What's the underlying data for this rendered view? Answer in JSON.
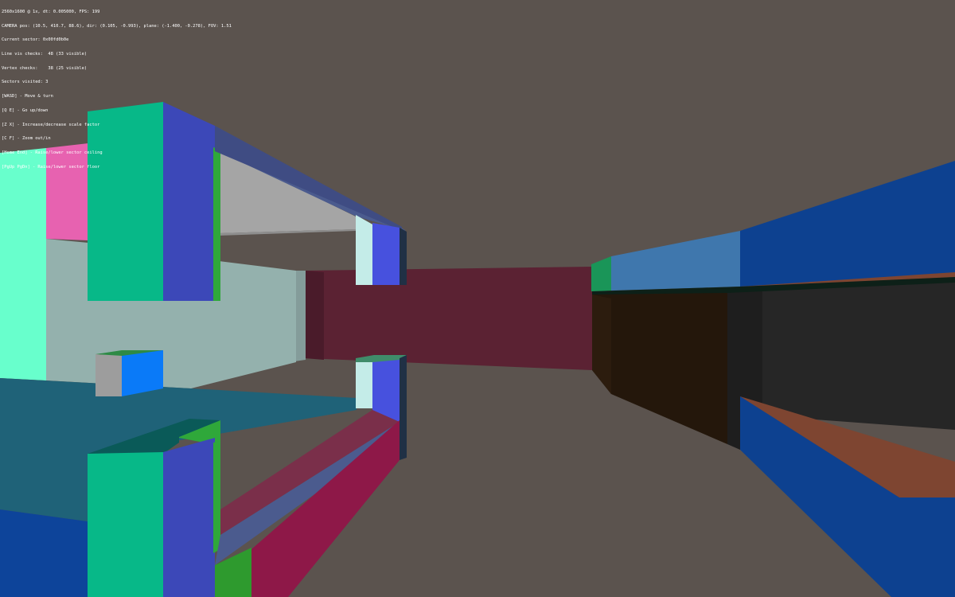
{
  "hud": {
    "lines": [
      "2560x1600 @ 1x, dt: 0.005000, FPS: 199",
      "CAMERA pos: (10.5, 410.7, 88.6), dir: (0.105, -0.993), plane: (-1.400, -0.278), FOV: 1.51",
      "Current sector: 0x00fd0b0e",
      "Line vis checks:  48 (33 visible)",
      "Vertex checks:    38 (25 visible)",
      "Sectors visited: 3",
      "[WASD] - Move & turn",
      "[Q E] - Go up/down",
      "[Z X] - Increase/decrease scale factor",
      "[C F] - Zoom out/in",
      "[Home End] - Raise/lower sector ceiling",
      "[PgUp PgDn] - Raise/lower sector floor"
    ]
  },
  "colors": {
    "background": "#5b534e",
    "hud_text": "#ffffff"
  }
}
